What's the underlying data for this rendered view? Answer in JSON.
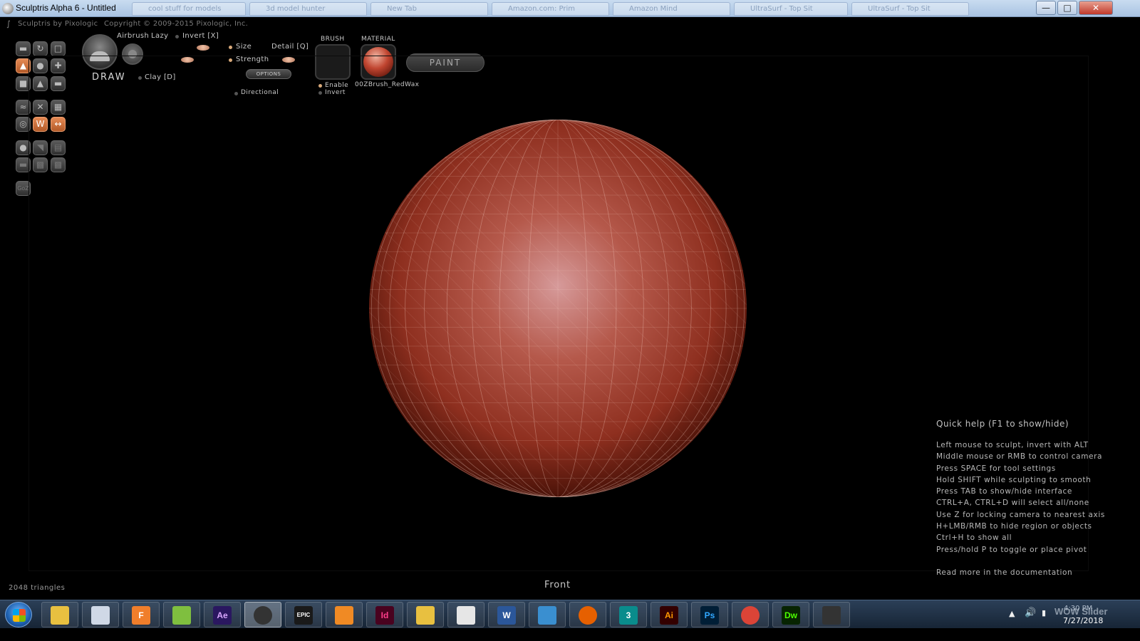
{
  "window": {
    "title": "Sculptris Alpha 6 - Untitled",
    "bg_tabs": [
      "cool stuff for models",
      "3d model hunter",
      "New Tab",
      "Amazon.com: Prim",
      "Amazon Mind",
      "UltraSurf - Top Sit",
      "UltraSurf - Top Sit"
    ],
    "controls": {
      "minimize": "—",
      "maximize": "□",
      "close": "✕"
    }
  },
  "app": {
    "brand": "Sculptris by Pixologic",
    "copyright": "Copyright © 2009-2015 Pixologic, Inc."
  },
  "toolbar": {
    "airbrush": "Airbrush",
    "lazy": "Lazy",
    "invert": "Invert [X]",
    "draw": "DRAW",
    "clay": "Clay [D]",
    "size": "Size",
    "detail": "Detail [Q]",
    "strength": "Strength",
    "options": "OPTIONS",
    "directional": "Directional",
    "brush_header": "BRUSH",
    "enable": "Enable",
    "brush_invert": "Invert",
    "material_header": "MATERIAL",
    "material_name": "00ZBrush_RedWax",
    "paint": "PAINT",
    "goz": "GoZ"
  },
  "quick_help": {
    "title": "Quick help (F1 to show/hide)",
    "lines": [
      "Left mouse to sculpt, invert with ALT",
      "Middle mouse or RMB to control camera",
      "Press SPACE for tool settings",
      "Hold SHIFT while sculpting to smooth",
      "Press TAB to show/hide interface",
      "CTRL+A, CTRL+D will select all/none",
      "Use Z for locking camera to nearest axis",
      "H+LMB/RMB to hide region or objects",
      "Ctrl+H to show all",
      "Press/hold P to toggle or place pivot"
    ],
    "more": "Read more in the documentation"
  },
  "status": {
    "triangles": "2048 triangles",
    "view": "Front"
  },
  "taskbar": {
    "apps": [
      {
        "name": "explorer",
        "label": ""
      },
      {
        "name": "3d-builder",
        "label": ""
      },
      {
        "name": "fusion",
        "label": "F"
      },
      {
        "name": "photo",
        "label": ""
      },
      {
        "name": "after-effects",
        "label": "Ae"
      },
      {
        "name": "sculptris",
        "label": ""
      },
      {
        "name": "epic-games",
        "label": "EPIC"
      },
      {
        "name": "media-player",
        "label": ""
      },
      {
        "name": "indesign",
        "label": "Id"
      },
      {
        "name": "folder",
        "label": ""
      },
      {
        "name": "acrobat",
        "label": ""
      },
      {
        "name": "word",
        "label": "W"
      },
      {
        "name": "photos",
        "label": ""
      },
      {
        "name": "firefox",
        "label": ""
      },
      {
        "name": "3ds-max",
        "label": "3"
      },
      {
        "name": "illustrator",
        "label": "Ai"
      },
      {
        "name": "photoshop",
        "label": "Ps"
      },
      {
        "name": "chrome",
        "label": ""
      },
      {
        "name": "dreamweaver",
        "label": "Dw"
      },
      {
        "name": "blender",
        "label": ""
      }
    ],
    "clock_time": "4:30 PM",
    "clock_date": "7/27/2018",
    "watermark": "WOW Slider"
  }
}
